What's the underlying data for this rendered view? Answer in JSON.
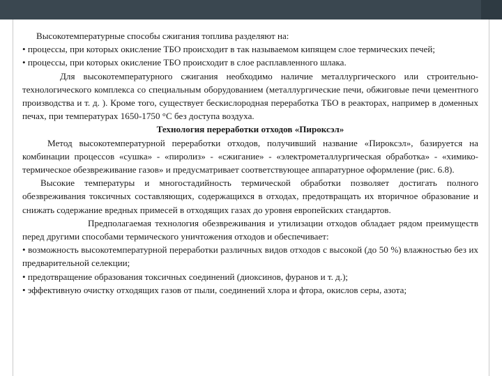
{
  "paragraphs": [
    "Высокотемпературные способы сжигания топлива разделяют на:",
    "• процессы, при которых окисление ТБО происходит в так называемом кипящем слое термических печей;",
    "• процессы, при которых окисление ТБО происходит в слое расплавленного шлака.",
    "Для высокотемпературного сжигания необходимо наличие металлургического или строительно-технологического комплекса со специальным оборудованием (металлургические печи, обжиговые печи цементного производства и т. д. ). Кроме того, существует бескислородная переработка ТБО в реакторах, например в доменных печах, при температурах 1650-1750 °С без доступа воздуха.",
    "Технология переработки отходов «Пироксэл»",
    "Метод высокотемпературной переработки отходов, получивший название «Пироксэл», базируется на комбинации процессов «сушка» - «пиролиз» - «сжигание» - «электрометаллургическая обработка» - «химико-термическое обезвреживание газов» и предусматривает соответствующее аппаратурное оформление (рис. 6.8).",
    "Высокие температуры и многостадийность термической обработки позволяет достигать полного обезвреживания токсичных составляющих, содержащихся в отходах, предотвращать их вторичное образование и снижать содержание вредных примесей в отходящих газах до уровня европейских стандартов.",
    "Предполагаемая технология обезвреживания и утилизации отходов обладает рядом преимуществ перед другими способами термического уничтожения отходов и обеспечивает:",
    "• возможность высокотемпературной переработки различных видов отходов с высокой (до 50 %) влажностью без их предварительной селекции;",
    "• предотвращение образования токсичных соединений (диоксинов, фуранов и т. д.);",
    "• эффективную очистку отходящих газов от пыли, соединений хлора и фтора, окислов серы, азота;"
  ]
}
